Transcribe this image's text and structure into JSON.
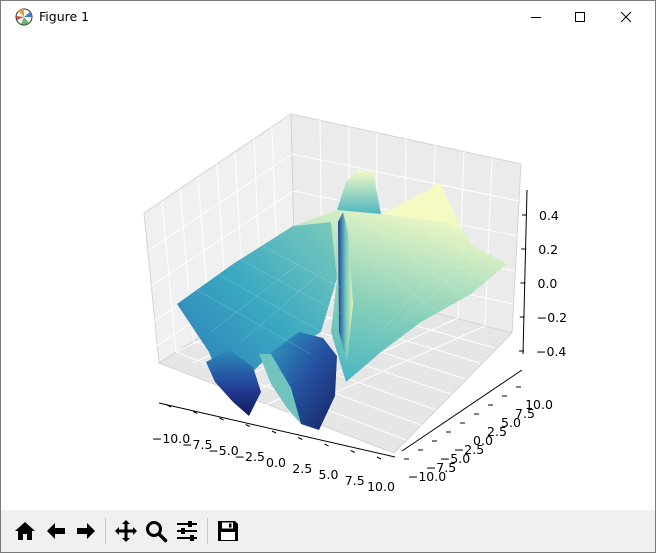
{
  "window": {
    "title": "Figure 1",
    "icon": "matplotlib-logo-icon"
  },
  "titlebar_buttons": [
    {
      "name": "minimize-button",
      "icon": "minimize-icon"
    },
    {
      "name": "maximize-button",
      "icon": "maximize-icon"
    },
    {
      "name": "close-button",
      "icon": "close-icon"
    }
  ],
  "toolbar": {
    "buttons": [
      {
        "name": "home-button",
        "icon": "home-icon"
      },
      {
        "name": "back-button",
        "icon": "arrow-left-icon"
      },
      {
        "name": "forward-button",
        "icon": "arrow-right-icon"
      },
      {
        "name": "pan-button",
        "icon": "move-icon"
      },
      {
        "name": "zoom-button",
        "icon": "magnifier-icon"
      },
      {
        "name": "configure-subplots-button",
        "icon": "sliders-icon"
      },
      {
        "name": "save-button",
        "icon": "floppy-disk-icon"
      }
    ]
  },
  "chart_data": {
    "type": "surface",
    "colormap": "YlGnBu",
    "title": "",
    "xlabel": "",
    "ylabel": "",
    "zlabel": "",
    "x_ticks": [
      "−10.0",
      "−7.5",
      "−5.0",
      "−2.5",
      "0.0",
      "2.5",
      "5.0",
      "7.5",
      "10.0"
    ],
    "y_ticks": [
      "−10.0",
      "−7.5",
      "−5.0",
      "−2.5",
      "0.0",
      "2.5",
      "5.0",
      "7.5",
      "10.0"
    ],
    "z_ticks": [
      "−0.4",
      "−0.2",
      "0.0",
      "0.2",
      "0.4"
    ],
    "x_range": [
      -10,
      10
    ],
    "y_range": [
      -10,
      10
    ],
    "z_range": [
      -0.5,
      0.5
    ],
    "grid": true
  }
}
